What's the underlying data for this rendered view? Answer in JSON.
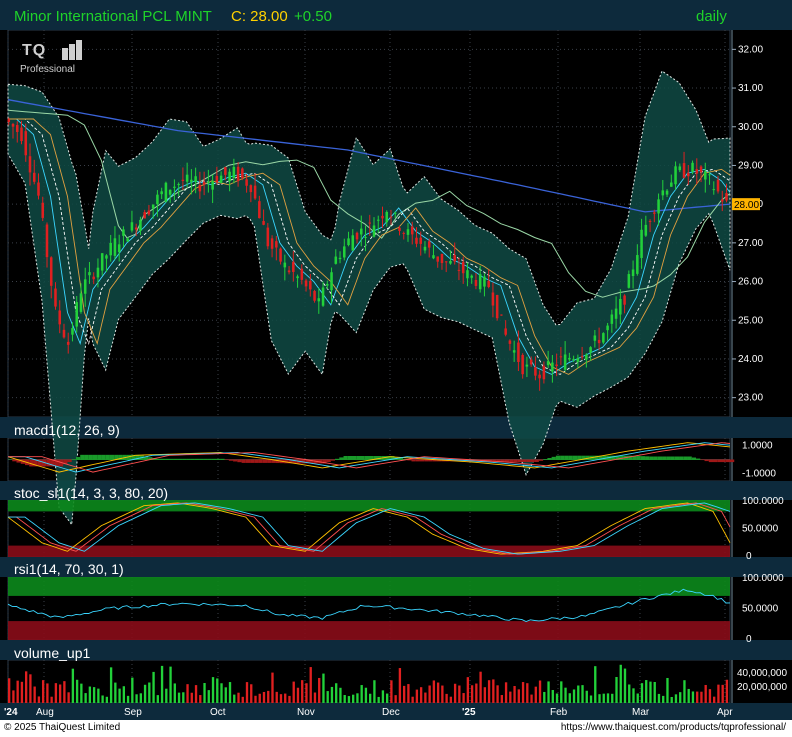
{
  "header": {
    "name": "Minor International PCL MINT",
    "price": "C: 28.00",
    "change": "+0.50",
    "period": "daily"
  },
  "logo": {
    "text": "TQ",
    "sub": "Professional"
  },
  "panels": {
    "macd": "macd1(12, 26, 9)",
    "stoch": "stoc_sl1(14, 3, 3, 80, 20)",
    "rsi": "rsi1(14, 70, 30, 1)",
    "volume": "volume_up1"
  },
  "footer": {
    "copyright": "© 2025 ThaiQuest Limited",
    "url": "https://www.thaiquest.com/products/tqprofessional/"
  },
  "colors": {
    "up": "#22d13a",
    "down": "#e02020",
    "title_bar": "#0d2a3c",
    "bands": "#0f4a44",
    "ma_long": "#3a63d8",
    "last_price_tag": "#ffb400"
  },
  "chart_data": [
    {
      "type": "candlestick",
      "title": "Minor International PCL MINT",
      "ylim": [
        22.5,
        32.5
      ],
      "y_ticks": [
        "32.00",
        "31.00",
        "30.00",
        "29.00",
        "28.00",
        "27.00",
        "26.00",
        "25.00",
        "24.00",
        "23.00"
      ],
      "last_price_label": "28.00",
      "x_ticks": [
        "'24",
        "Aug",
        "Sep",
        "Oct",
        "Nov",
        "Dec",
        "'25",
        "Feb",
        "Mar",
        "Apr"
      ],
      "close_path": [
        [
          0,
          30.2
        ],
        [
          4,
          29.8
        ],
        [
          8,
          28.2
        ],
        [
          12,
          25.2
        ],
        [
          15,
          24.4
        ],
        [
          18,
          25.8
        ],
        [
          22,
          26.4
        ],
        [
          26,
          27.0
        ],
        [
          30,
          27.4
        ],
        [
          34,
          27.9
        ],
        [
          38,
          28.4
        ],
        [
          42,
          28.6
        ],
        [
          46,
          28.5
        ],
        [
          50,
          28.7
        ],
        [
          54,
          28.8
        ],
        [
          58,
          28.5
        ],
        [
          62,
          27.0
        ],
        [
          66,
          26.4
        ],
        [
          70,
          26.0
        ],
        [
          74,
          25.4
        ],
        [
          78,
          26.6
        ],
        [
          82,
          27.2
        ],
        [
          86,
          27.4
        ],
        [
          90,
          27.9
        ],
        [
          94,
          27.3
        ],
        [
          98,
          27.0
        ],
        [
          102,
          26.6
        ],
        [
          106,
          26.4
        ],
        [
          110,
          26.1
        ],
        [
          114,
          25.9
        ],
        [
          118,
          24.6
        ],
        [
          122,
          23.8
        ],
        [
          126,
          23.6
        ],
        [
          130,
          23.9
        ],
        [
          134,
          24.1
        ],
        [
          138,
          24.3
        ],
        [
          142,
          24.8
        ],
        [
          146,
          25.6
        ],
        [
          150,
          27.2
        ],
        [
          154,
          28.2
        ],
        [
          158,
          28.8
        ],
        [
          162,
          28.9
        ],
        [
          166,
          28.6
        ],
        [
          170,
          28.0
        ]
      ],
      "series": [
        {
          "name": "MA long",
          "values": [
            [
              0,
              30.7
            ],
            [
              40,
              29.9
            ],
            [
              80,
              29.4
            ],
            [
              120,
              28.5
            ],
            [
              150,
              27.8
            ],
            [
              170,
              28.0
            ]
          ]
        }
      ]
    },
    {
      "type": "line",
      "title": "macd1(12, 26, 9)",
      "y_ticks": [
        "1.0000",
        "-1.0000"
      ],
      "series": [
        {
          "name": "macd",
          "values": [
            [
              0,
              0.2
            ],
            [
              12,
              -0.9
            ],
            [
              30,
              0.3
            ],
            [
              50,
              0.5
            ],
            [
              62,
              0.0
            ],
            [
              74,
              -0.6
            ],
            [
              90,
              0.2
            ],
            [
              110,
              -0.2
            ],
            [
              124,
              -0.6
            ],
            [
              146,
              0.6
            ],
            [
              160,
              1.2
            ],
            [
              170,
              0.9
            ]
          ]
        }
      ]
    },
    {
      "type": "line",
      "title": "stoc_sl1(14, 3, 3, 80, 20)",
      "ylim": [
        0,
        100
      ],
      "y_ticks": [
        "100.0000",
        "50.0000",
        "0"
      ],
      "series": [
        {
          "name": "%K",
          "values": [
            [
              0,
              70
            ],
            [
              8,
              25
            ],
            [
              14,
              10
            ],
            [
              22,
              55
            ],
            [
              32,
              90
            ],
            [
              40,
              95
            ],
            [
              48,
              85
            ],
            [
              56,
              70
            ],
            [
              62,
              20
            ],
            [
              70,
              10
            ],
            [
              78,
              60
            ],
            [
              86,
              85
            ],
            [
              94,
              70
            ],
            [
              100,
              40
            ],
            [
              108,
              15
            ],
            [
              116,
              5
            ],
            [
              126,
              10
            ],
            [
              134,
              20
            ],
            [
              142,
              55
            ],
            [
              150,
              85
            ],
            [
              160,
              95
            ],
            [
              166,
              80
            ],
            [
              170,
              25
            ]
          ]
        }
      ]
    },
    {
      "type": "line",
      "title": "rsi1(14, 70, 30, 1)",
      "ylim": [
        0,
        100
      ],
      "y_ticks": [
        "100.0000",
        "50.0000",
        "0"
      ],
      "series": [
        {
          "name": "rsi",
          "values": [
            [
              0,
              55
            ],
            [
              12,
              35
            ],
            [
              24,
              50
            ],
            [
              40,
              58
            ],
            [
              56,
              55
            ],
            [
              64,
              40
            ],
            [
              74,
              35
            ],
            [
              84,
              55
            ],
            [
              94,
              50
            ],
            [
              110,
              40
            ],
            [
              122,
              30
            ],
            [
              136,
              38
            ],
            [
              150,
              65
            ],
            [
              160,
              80
            ],
            [
              166,
              70
            ],
            [
              170,
              58
            ]
          ]
        }
      ]
    },
    {
      "type": "bar",
      "title": "volume_up1",
      "y_ticks": [
        "40,000,000",
        "20,000,000"
      ]
    }
  ]
}
